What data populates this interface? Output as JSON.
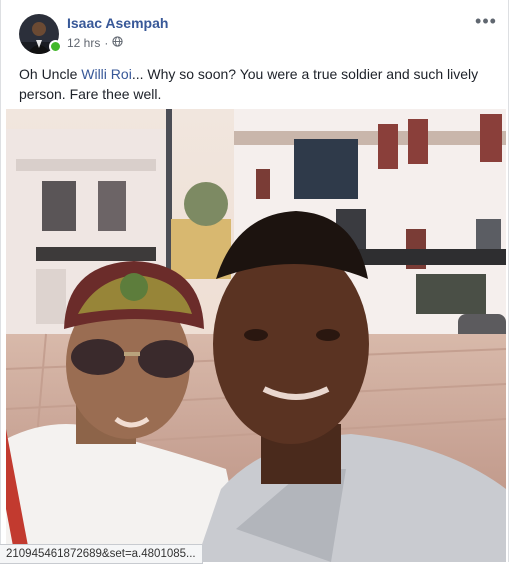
{
  "post": {
    "author": "Isaac Asempah",
    "timestamp": "12 hrs",
    "separator": "·",
    "privacy_icon": "globe-icon",
    "more_label": "•••",
    "text": {
      "prefix": "Oh Uncle ",
      "mention": "Willi Roi",
      "suffix": "... Why so soon? You were a true soldier and such lively person. Fare thee well."
    }
  },
  "status_bar": {
    "url": "210945461872689&set=a.4801085..."
  },
  "colors": {
    "link": "#385898",
    "online": "#42b72a",
    "meta": "#616770"
  }
}
